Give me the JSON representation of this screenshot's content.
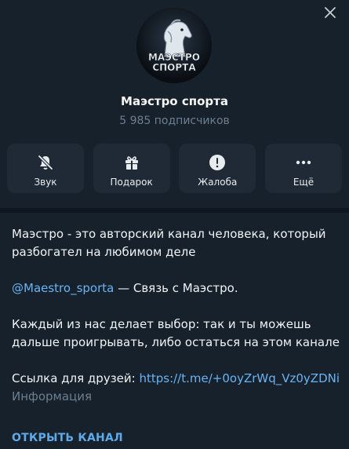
{
  "channel": {
    "name": "Маэстро спорта",
    "subscribers": "5 985 подписчиков",
    "avatar_text_top": "МАЭСТРО",
    "avatar_text_bottom": "СПОРТА"
  },
  "actions": [
    {
      "label": "Звук",
      "icon": "bell-off-icon"
    },
    {
      "label": "Подарок",
      "icon": "gift-icon"
    },
    {
      "label": "Жалоба",
      "icon": "warning-icon"
    },
    {
      "label": "Ещё",
      "icon": "more-icon"
    }
  ],
  "info": {
    "line1": "Маэстро - это авторский канал человека, который разбогател на любимом деле",
    "contact_link": "@Maestro_sporta",
    "contact_text": " — Связь с Маэстро.",
    "line3": "Каждый из нас делает выбор: так и ты можешь дальше проигрывать, либо остаться на этом канале",
    "friends_label": "Ссылка для друзей: ",
    "friends_link": "https://t.me/+0oyZrWq_Vz0yZDNi",
    "caption": "Информация"
  },
  "footer": {
    "open_channel": "ОТКРЫТЬ КАНАЛ"
  },
  "colors": {
    "background": "#17212b",
    "button_bg": "#1f2a36",
    "accent": "#6ab3f3",
    "muted": "#6d7f8f"
  }
}
